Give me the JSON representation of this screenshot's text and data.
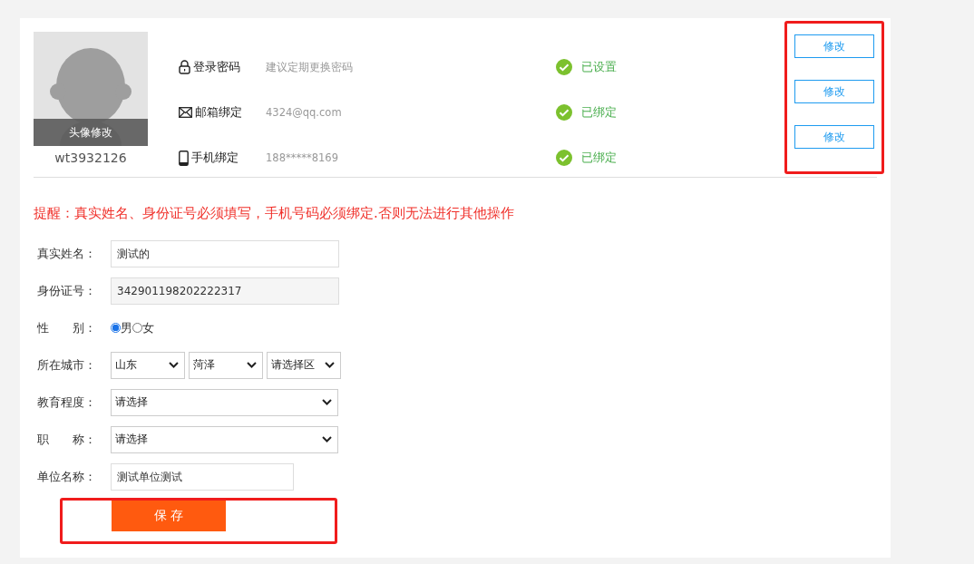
{
  "profile": {
    "avatar_caption": "头像修改",
    "username": "wt3932126"
  },
  "security": [
    {
      "kind": "lock",
      "label": "登录密码",
      "value": "建议定期更换密码",
      "status": "已设置",
      "done": true,
      "button": "修改"
    },
    {
      "kind": "mail",
      "label": "邮箱绑定",
      "value": "4324@qq.com",
      "status": "已绑定",
      "done": true,
      "button": "修改"
    },
    {
      "kind": "phone",
      "label": "手机绑定",
      "value": "188*****8169",
      "status": "已绑定",
      "done": true,
      "button": "修改"
    }
  ],
  "notice": "提醒：真实姓名、身份证号必须填写，手机号码必须绑定.否则无法进行其他操作",
  "form": [
    {
      "kind": "text",
      "label": "真实姓名：",
      "value": "测试的"
    },
    {
      "kind": "readonly",
      "label": "身份证号：",
      "value": "342901198202222317"
    },
    {
      "kind": "radio",
      "label": "性　　别：",
      "options": [
        {
          "label": "男",
          "selected": true
        },
        {
          "label": "女",
          "selected": false
        }
      ]
    },
    {
      "kind": "selects",
      "label": "所在城市：",
      "values": [
        "山东",
        "菏泽",
        "请选择区"
      ]
    },
    {
      "kind": "select",
      "label": "教育程度：",
      "value": "请选择"
    },
    {
      "kind": "select",
      "label": "职　　称：",
      "value": "请选择"
    },
    {
      "kind": "short",
      "label": "单位名称：",
      "value": "测试单位测试"
    }
  ],
  "save_button": "保 存"
}
